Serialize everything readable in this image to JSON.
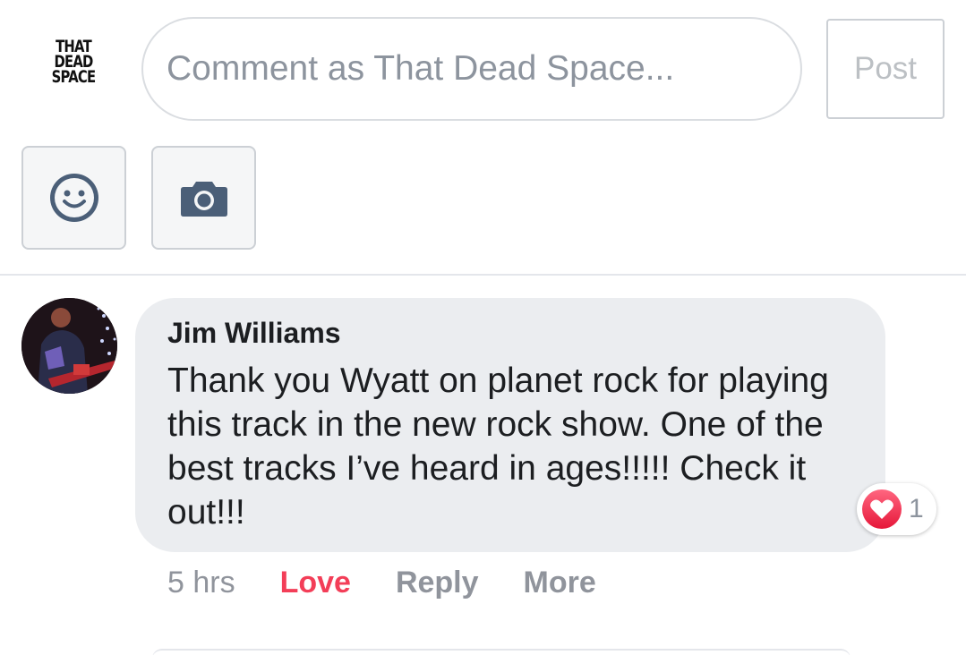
{
  "composer": {
    "page_logo_text": [
      "THAT",
      "DEAD",
      "SPACE"
    ],
    "input_placeholder": "Comment as That Dead Space...",
    "input_value": "",
    "post_label": "Post",
    "emoji_icon": "smiley-icon",
    "camera_icon": "camera-icon"
  },
  "comment": {
    "author": "Jim Williams",
    "text": "Thank you Wyatt on planet rock for playing this track in the new rock show. One of the best tracks I’ve heard in ages!!!!! Check it out!!!",
    "reaction": {
      "icon": "love-reaction-icon",
      "count": "1",
      "color": "#f33e58"
    },
    "timestamp": "5 hrs",
    "actions": {
      "love": "Love",
      "reply": "Reply",
      "more": "More"
    }
  },
  "colors": {
    "bubble_bg": "#ebedf0",
    "love_red": "#f33e58",
    "secondary_text": "#90949c",
    "icon_slate": "#4b5f78"
  }
}
